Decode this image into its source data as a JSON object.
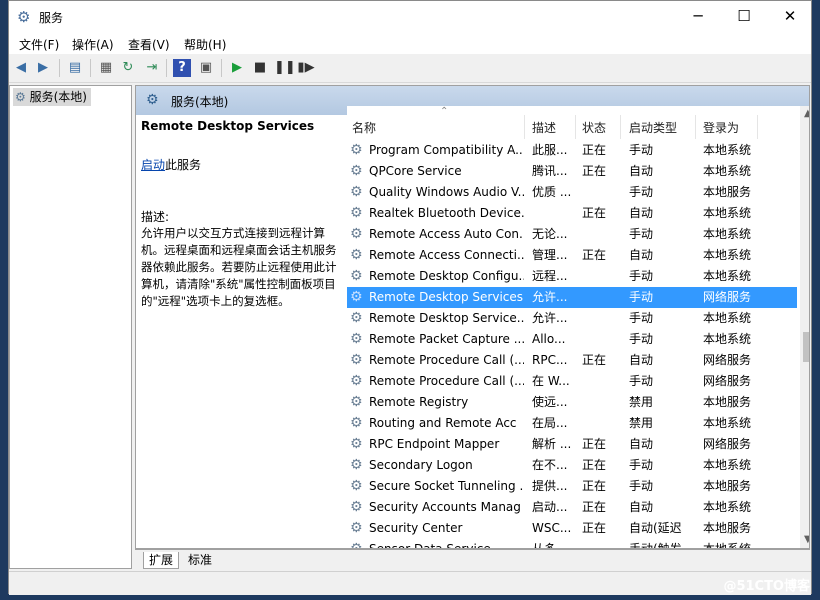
{
  "window": {
    "title": "服务",
    "minimize": "─",
    "maximize": "☐",
    "close": "✕"
  },
  "menu": [
    "文件(F)",
    "操作(A)",
    "查看(V)",
    "帮助(H)"
  ],
  "tree": {
    "root": "服务(本地)"
  },
  "panel": {
    "title": "服务(本地)"
  },
  "details": {
    "service_name": "Remote Desktop Services",
    "start_link": "启动",
    "start_suffix": "此服务",
    "desc_label": "描述:",
    "desc_text": "允许用户以交互方式连接到远程计算机。远程桌面和远程桌面会话主机服务器依赖此服务。若要防止远程使用此计算机，请清除\"系统\"属性控制面板项目的\"远程\"选项卡上的复选框。"
  },
  "columns": [
    "名称",
    "描述",
    "状态",
    "启动类型",
    "登录为"
  ],
  "rows": [
    {
      "name": "Program Compatibility A...",
      "desc": "此服...",
      "status": "正在",
      "startup": "手动",
      "logon": "本地系统"
    },
    {
      "name": "QPCore Service",
      "desc": "腾讯...",
      "status": "正在",
      "startup": "自动",
      "logon": "本地系统"
    },
    {
      "name": "Quality Windows Audio V...",
      "desc": "优质 ...",
      "status": "",
      "startup": "手动",
      "logon": "本地服务"
    },
    {
      "name": "Realtek Bluetooth Device...",
      "desc": "",
      "status": "正在",
      "startup": "自动",
      "logon": "本地系统"
    },
    {
      "name": "Remote Access Auto Con...",
      "desc": "无论...",
      "status": "",
      "startup": "手动",
      "logon": "本地系统"
    },
    {
      "name": "Remote Access Connecti...",
      "desc": "管理...",
      "status": "正在",
      "startup": "自动",
      "logon": "本地系统"
    },
    {
      "name": "Remote Desktop Configu...",
      "desc": "远程...",
      "status": "",
      "startup": "手动",
      "logon": "本地系统"
    },
    {
      "name": "Remote Desktop Services",
      "desc": "允许...",
      "status": "",
      "startup": "手动",
      "logon": "网络服务",
      "selected": true
    },
    {
      "name": "Remote Desktop Service...",
      "desc": "允许...",
      "status": "",
      "startup": "手动",
      "logon": "本地系统"
    },
    {
      "name": "Remote Packet Capture ...",
      "desc": "Allo...",
      "status": "",
      "startup": "手动",
      "logon": "本地系统"
    },
    {
      "name": "Remote Procedure Call (...",
      "desc": "RPC...",
      "status": "正在",
      "startup": "自动",
      "logon": "网络服务"
    },
    {
      "name": "Remote Procedure Call (...",
      "desc": "在 W...",
      "status": "",
      "startup": "手动",
      "logon": "网络服务"
    },
    {
      "name": "Remote Registry",
      "desc": "使远...",
      "status": "",
      "startup": "禁用",
      "logon": "本地服务"
    },
    {
      "name": "Routing and Remote Acc",
      "desc": "在局...",
      "status": "",
      "startup": "禁用",
      "logon": "本地系统"
    },
    {
      "name": "RPC Endpoint Mapper",
      "desc": "解析 ...",
      "status": "正在",
      "startup": "自动",
      "logon": "网络服务"
    },
    {
      "name": "Secondary Logon",
      "desc": "在不...",
      "status": "正在",
      "startup": "手动",
      "logon": "本地系统"
    },
    {
      "name": "Secure Socket Tunneling ...",
      "desc": "提供...",
      "status": "正在",
      "startup": "手动",
      "logon": "本地服务"
    },
    {
      "name": "Security Accounts Manag",
      "desc": "启动...",
      "status": "正在",
      "startup": "自动",
      "logon": "本地系统"
    },
    {
      "name": "Security Center",
      "desc": "WSC...",
      "status": "正在",
      "startup": "自动(延迟",
      "logon": "本地服务"
    },
    {
      "name": "Sensor Data Service",
      "desc": "从多...",
      "status": "",
      "startup": "手动(触发",
      "logon": "本地系统"
    }
  ],
  "tabs": [
    "扩展",
    "标准"
  ],
  "watermark": "@51CTO博客"
}
